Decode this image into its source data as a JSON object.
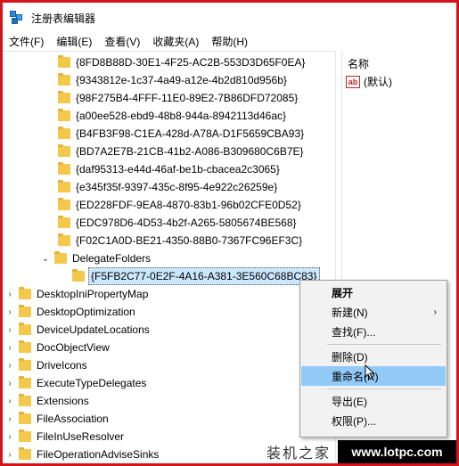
{
  "window": {
    "title": "注册表编辑器"
  },
  "menubar": [
    "文件(F)",
    "编辑(E)",
    "查看(V)",
    "收藏夹(A)",
    "帮助(H)"
  ],
  "tree": {
    "guid_items": [
      "{8FD8B88D-30E1-4F25-AC2B-553D3D65F0EA}",
      "{9343812e-1c37-4a49-a12e-4b2d810d956b}",
      "{98F275B4-4FFF-11E0-89E2-7B86DFD72085}",
      "{a00ee528-ebd9-48b8-944a-8942113d46ac}",
      "{B4FB3F98-C1EA-428d-A78A-D1F5659CBA93}",
      "{BD7A2E7B-21CB-41b2-A086-B309680C6B7E}",
      "{daf95313-e44d-46af-be1b-cbacea2c3065}",
      "{e345f35f-9397-435c-8f95-4e922c26259e}",
      "{ED228FDF-9EA8-4870-83b1-96b02CFE0D52}",
      "{EDC978D6-4D53-4b2f-A265-5805674BE568}",
      "{F02C1A0D-BE21-4350-88B0-7367FC96EF3C}"
    ],
    "delegate_folders": "DelegateFolders",
    "selected_key": "{F5FB2C77-0E2F-4A16-A381-3E560C68BC83}",
    "bottom_items": [
      "DesktopIniPropertyMap",
      "DesktopOptimization",
      "DeviceUpdateLocations",
      "DocObjectView",
      "DriveIcons",
      "ExecuteTypeDelegates",
      "Extensions",
      "FileAssociation",
      "FileInUseResolver",
      "FileOperationAdviseSinks"
    ]
  },
  "detail": {
    "column_name": "名称",
    "default_value_icon": "ab",
    "default_value": "(默认)"
  },
  "context_menu": {
    "expand": "展开",
    "new": "新建(N)",
    "find": "查找(F)...",
    "delete": "删除(D)",
    "rename": "重命名(R)",
    "export": "导出(E)",
    "permissions": "权限(P)..."
  },
  "watermark": {
    "cn": "装机之家",
    "url": "www.lotpc.com"
  },
  "colors": {
    "frame_border": "#d3141c",
    "selection": "#cce8ff",
    "menu_highlight": "#91c9f7",
    "folder": "#f4c84b"
  }
}
